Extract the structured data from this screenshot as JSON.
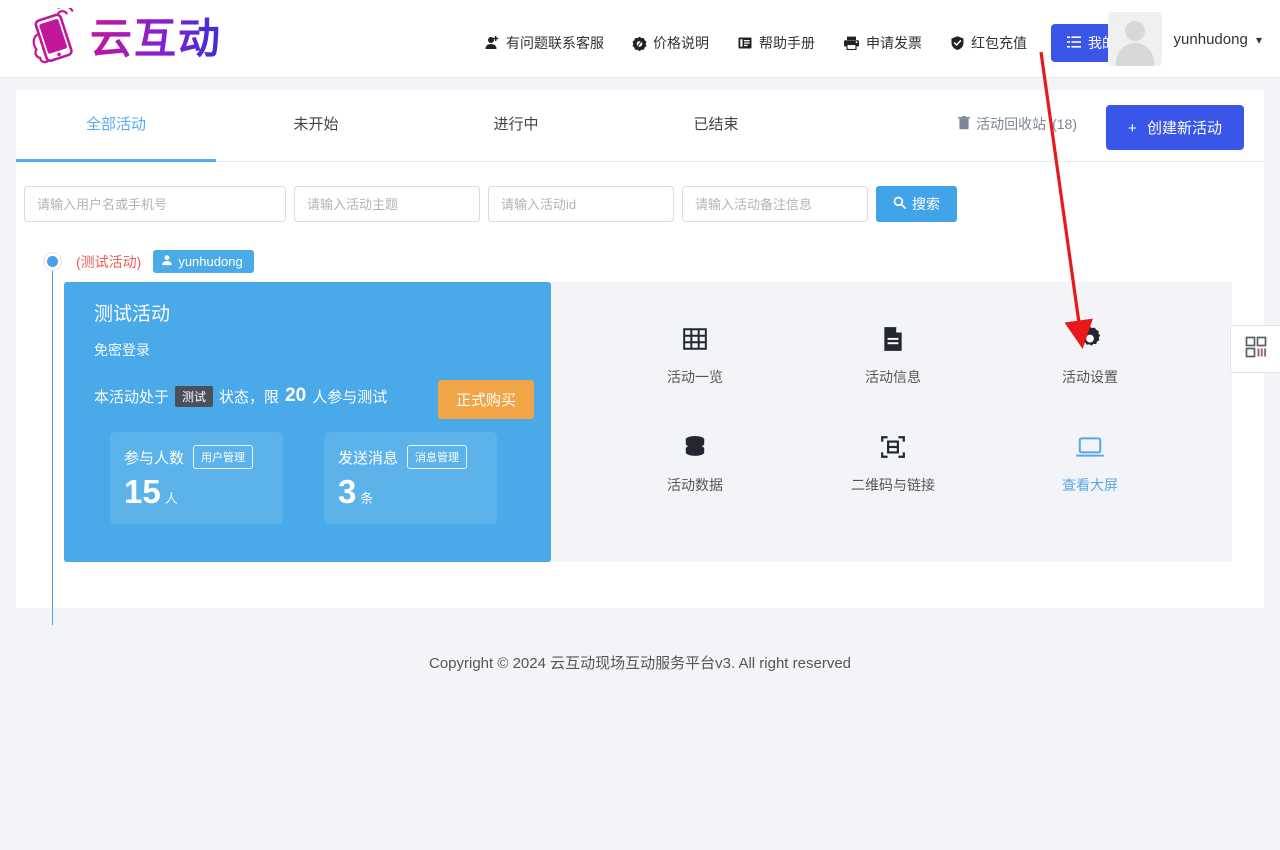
{
  "header": {
    "logo_text": "云互动",
    "logo_icon": "hand-holding-phone-icon",
    "nav": [
      {
        "label": "有问题联系客服",
        "icon": "add-user-icon"
      },
      {
        "label": "价格说明",
        "icon": "price-tag-icon"
      },
      {
        "label": "帮助手册",
        "icon": "book-icon"
      },
      {
        "label": "申请发票",
        "icon": "printer-icon"
      },
      {
        "label": "红包充值",
        "icon": "shield-check-icon"
      }
    ],
    "my_activity_button": {
      "label": "我的活动",
      "icon": "list-icon",
      "color": "#3a56e8"
    },
    "user": {
      "name": "yunhudong",
      "avatar": "default-user-avatar",
      "caret": "▾"
    }
  },
  "tabs": [
    {
      "label": "全部活动",
      "active": true
    },
    {
      "label": "未开始",
      "active": false
    },
    {
      "label": "进行中",
      "active": false
    },
    {
      "label": "已结束",
      "active": false
    }
  ],
  "toolbar": {
    "recycle_bin": {
      "label": "活动回收站",
      "count": "(18)",
      "icon": "trash-icon"
    },
    "create_button": {
      "label": "创建新活动",
      "plus": "+",
      "color": "#3a56e8"
    }
  },
  "search": {
    "fields": [
      {
        "placeholder": "请输入用户名或手机号",
        "value": ""
      },
      {
        "placeholder": "请输入活动主题",
        "value": ""
      },
      {
        "placeholder": "请输入活动id",
        "value": ""
      },
      {
        "placeholder": "请输入活动备注信息",
        "value": ""
      }
    ],
    "button": {
      "label": "搜索",
      "icon": "search-icon",
      "color": "#41a3e8"
    }
  },
  "activity": {
    "tag_test": "(测试活动)",
    "owner_badge": {
      "label": "yunhudong",
      "icon": "user-icon"
    },
    "card": {
      "title": "测试活动",
      "subtitle": "免密登录",
      "status_prefix": "本活动处于",
      "status_chip": "测试",
      "status_mid": "状态，限",
      "status_number": "20",
      "status_suffix": "人参与测试",
      "buy_button": {
        "label": "正式购买",
        "color": "#f1a546"
      },
      "stats": [
        {
          "label": "参与人数",
          "action": "用户管理",
          "value": "15",
          "unit": "人"
        },
        {
          "label": "发送消息",
          "action": "消息管理",
          "value": "3",
          "unit": "条"
        }
      ]
    },
    "menu": [
      {
        "label": "活动一览",
        "icon": "grid-icon",
        "highlight": false
      },
      {
        "label": "活动信息",
        "icon": "document-icon",
        "highlight": false
      },
      {
        "label": "活动设置",
        "icon": "gear-icon",
        "highlight": false
      },
      {
        "label": "活动数据",
        "icon": "database-icon",
        "highlight": false
      },
      {
        "label": "二维码与链接",
        "icon": "qrcode-scan-icon",
        "highlight": false
      },
      {
        "label": "查看大屏",
        "icon": "laptop-screen-icon",
        "highlight": true
      }
    ]
  },
  "side_tab": {
    "icon": "apps-grid-icon"
  },
  "footer": {
    "text": "Copyright © 2024 云互动现场互动服务平台v3. All right reserved"
  },
  "annotation": {
    "type": "arrow",
    "color": "#e8191b",
    "points_to": "活动设置"
  }
}
